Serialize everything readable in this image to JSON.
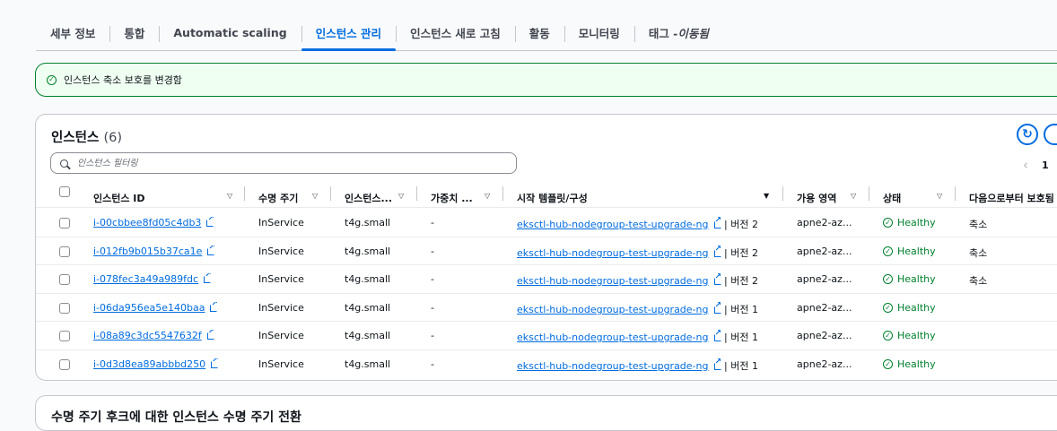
{
  "tabs": [
    {
      "label": "세부 정보"
    },
    {
      "label": "통합"
    },
    {
      "label": "Automatic scaling"
    },
    {
      "label": "인스턴스 관리"
    },
    {
      "label": "인스턴스 새로 고침"
    },
    {
      "label": "활동"
    },
    {
      "label": "모니터링"
    },
    {
      "label": "태그 - ",
      "suffix": "이동됨"
    }
  ],
  "flash": {
    "message": "인스턴스 축소 보호를 변경함",
    "icon": "check-circle-icon"
  },
  "instances": {
    "title": "인스턴스",
    "count": "(6)",
    "filter_placeholder": "인스턴스 필터링",
    "pager_page": "1",
    "columns": [
      "인스턴스 ID",
      "수명 주기",
      "인스턴스...",
      "가중치 ...",
      "시작 템플릿/구성",
      "가용 영역",
      "상태",
      "다음으로부터 보호됨"
    ],
    "rows": [
      {
        "id": "i-00cbbee8fd05c4db3",
        "lifecycle": "InService",
        "type": "t4g.small",
        "weight": "-",
        "template": "eksctl-hub-nodegroup-test-upgrade-ng",
        "version": "| 버전 2",
        "az": "apne2-az...",
        "status": "Healthy",
        "protected": "축소"
      },
      {
        "id": "i-012fb9b015b37ca1e",
        "lifecycle": "InService",
        "type": "t4g.small",
        "weight": "-",
        "template": "eksctl-hub-nodegroup-test-upgrade-ng",
        "version": "| 버전 2",
        "az": "apne2-az...",
        "status": "Healthy",
        "protected": "축소"
      },
      {
        "id": "i-078fec3a49a989fdc",
        "lifecycle": "InService",
        "type": "t4g.small",
        "weight": "-",
        "template": "eksctl-hub-nodegroup-test-upgrade-ng",
        "version": "| 버전 2",
        "az": "apne2-az...",
        "status": "Healthy",
        "protected": "축소"
      },
      {
        "id": "i-06da956ea5e140baa",
        "lifecycle": "InService",
        "type": "t4g.small",
        "weight": "-",
        "template": "eksctl-hub-nodegroup-test-upgrade-ng",
        "version": "| 버전 1",
        "az": "apne2-az...",
        "status": "Healthy",
        "protected": ""
      },
      {
        "id": "i-08a89c3dc5547632f",
        "lifecycle": "InService",
        "type": "t4g.small",
        "weight": "-",
        "template": "eksctl-hub-nodegroup-test-upgrade-ng",
        "version": "| 버전 1",
        "az": "apne2-az...",
        "status": "Healthy",
        "protected": ""
      },
      {
        "id": "i-0d3d8ea89abbbd250",
        "lifecycle": "InService",
        "type": "t4g.small",
        "weight": "-",
        "template": "eksctl-hub-nodegroup-test-upgrade-ng",
        "version": "| 버전 1",
        "az": "apne2-az...",
        "status": "Healthy",
        "protected": ""
      }
    ]
  },
  "lifecycle_section": {
    "title": "수명 주기 후크에 대한 인스턴스 수명 주기 전환"
  },
  "colors": {
    "accent": "#006ce0",
    "success": "#00802f",
    "border": "#c6c6cd"
  }
}
